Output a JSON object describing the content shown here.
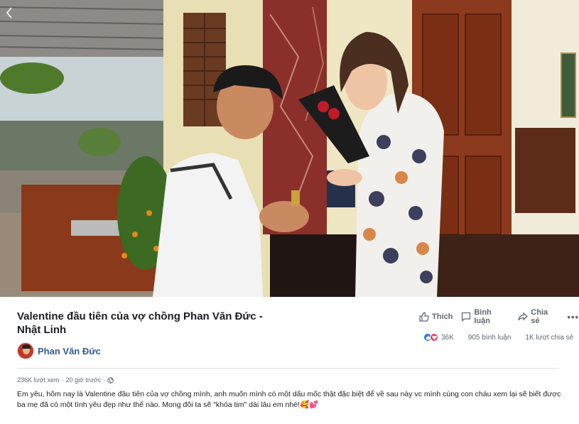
{
  "video": {
    "back_icon": "chevron-left-icon"
  },
  "post": {
    "title": "Valentine đầu tiên của vợ chồng Phan Văn Đức - Nhật Linh",
    "channel_name": "Phan Văn Đức",
    "actions": {
      "like_label": "Thích",
      "comment_label": "Bình luận",
      "share_label": "Chia sẻ",
      "more_label": "•••"
    },
    "stats": {
      "reaction_count": "36K",
      "comment_count": "905 bình luận",
      "share_count": "1K lượt chia sẻ"
    },
    "meta": {
      "views": "236K lượt xem",
      "separator": "·",
      "time": "20 giờ trước",
      "separator2": "·"
    },
    "description": "Em yêu, hôm nay là Valentine đầu tiên của vợ chồng mình, anh muốn mình có một dấu mốc thật đặc biệt để về sau này vc mình cùng con cháu xem lại sẽ biết được ba mẹ đã có một tình yêu đẹp như thế nào. Mong đôi ta sẽ \"khóa tim\" dài lâu em nhé!🥰💕"
  },
  "colors": {
    "link_blue": "#385898",
    "text_dark": "#1c1e21",
    "text_gray": "#606770",
    "like_blue": "#1877f2",
    "love_red": "#f33e58"
  }
}
